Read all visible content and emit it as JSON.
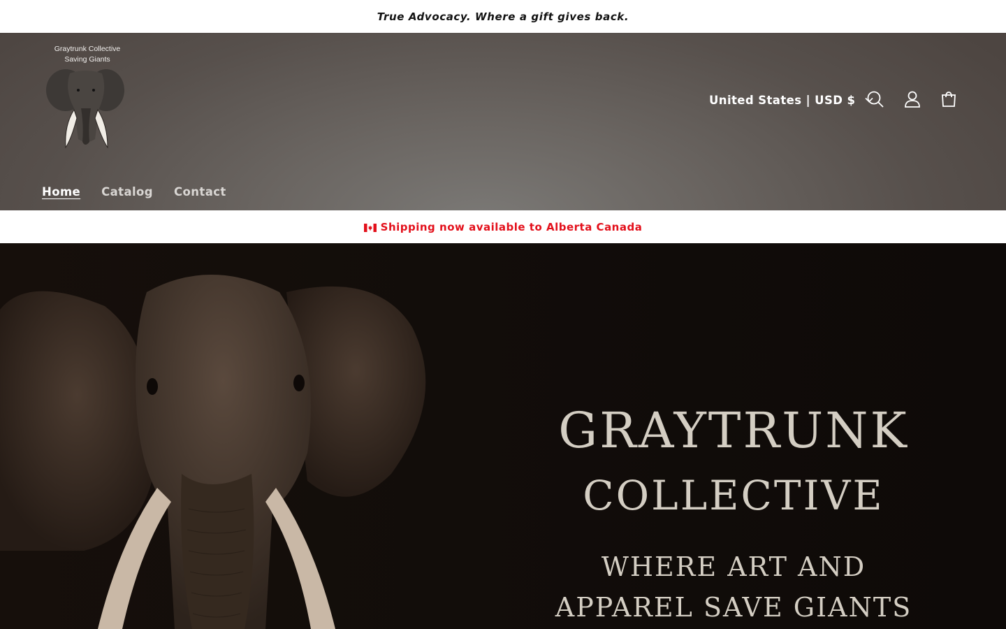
{
  "announcement": {
    "text": "True Advocacy. Where a gift gives back."
  },
  "logo": {
    "line1": "Graytrunk Collective",
    "line2": "Saving Giants"
  },
  "header": {
    "country_selector": "United States | USD $",
    "icons": [
      "search-icon",
      "account-icon",
      "cart-icon"
    ]
  },
  "nav": {
    "items": [
      {
        "label": "Home"
      },
      {
        "label": "Catalog"
      },
      {
        "label": "Contact"
      }
    ]
  },
  "shipping": {
    "flag": "🇨🇦",
    "text": "Shipping now available to Alberta Canada",
    "color": "#e3101b"
  },
  "hero": {
    "line1": "GRAYTRUNK",
    "line2": "COLLECTIVE",
    "line3": "WHERE ART AND",
    "line4": "APPAREL SAVE GIANTS"
  }
}
